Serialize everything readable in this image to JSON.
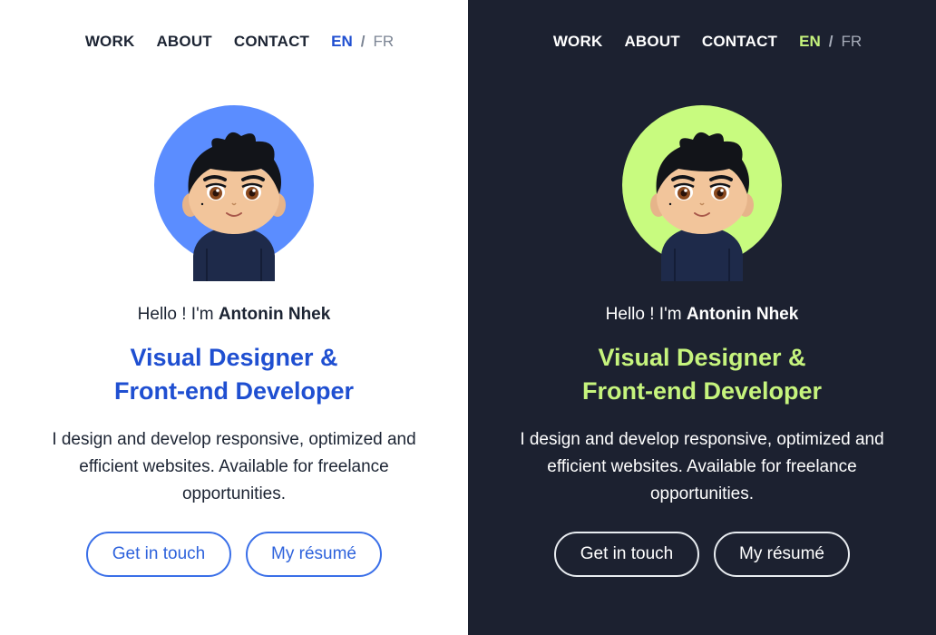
{
  "nav": {
    "work": "WORK",
    "about": "ABOUT",
    "contact": "CONTACT",
    "lang_en": "EN",
    "lang_sep": "/",
    "lang_fr": "FR"
  },
  "hero": {
    "hello_prefix": "Hello ! I'm ",
    "name": "Antonin Nhek",
    "headline_line1": "Visual Designer &",
    "headline_line2": "Front-end Developer",
    "description": "I design and develop responsive, optimized and efficient websites. Available for freelance opportunities.",
    "cta_contact": "Get in touch",
    "cta_resume": "My résumé"
  },
  "themes": {
    "light": {
      "background": "#ffffff",
      "accent": "#1f4fd1",
      "avatar_circle": "#5b8dff"
    },
    "dark": {
      "background": "#1c2130",
      "accent": "#c6f47d",
      "avatar_circle": "#c8fb7f"
    }
  },
  "avatar_icon": "cartoon-portrait"
}
